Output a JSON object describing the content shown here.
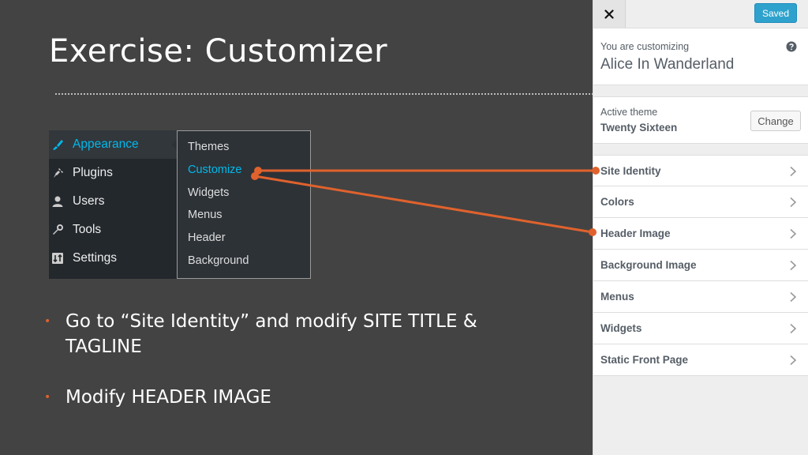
{
  "slide": {
    "title": "Exercise: Customizer",
    "bullets": [
      "Go to “Site Identity” and modify SITE TITLE & TAGLINE",
      "Modify HEADER IMAGE"
    ]
  },
  "wp_menu": {
    "items": [
      {
        "label": "Appearance",
        "icon": "paintbrush-icon"
      },
      {
        "label": "Plugins",
        "icon": "plugin-icon"
      },
      {
        "label": "Users",
        "icon": "user-icon"
      },
      {
        "label": "Tools",
        "icon": "wrench-icon"
      },
      {
        "label": "Settings",
        "icon": "settings-icon"
      }
    ],
    "submenu": [
      "Themes",
      "Customize",
      "Widgets",
      "Menus",
      "Header",
      "Background"
    ]
  },
  "customizer": {
    "saved_label": "Saved",
    "customizing_label": "You are customizing",
    "site_name": "Alice In Wanderland",
    "active_theme_label": "Active theme",
    "theme_name": "Twenty Sixteen",
    "change_label": "Change",
    "sections": [
      "Site Identity",
      "Colors",
      "Header Image",
      "Background Image",
      "Menus",
      "Widgets",
      "Static Front Page"
    ]
  },
  "colors": {
    "accent": "#e0622d",
    "wp_blue": "#00b9eb",
    "saved_blue": "#2ea2cc"
  }
}
